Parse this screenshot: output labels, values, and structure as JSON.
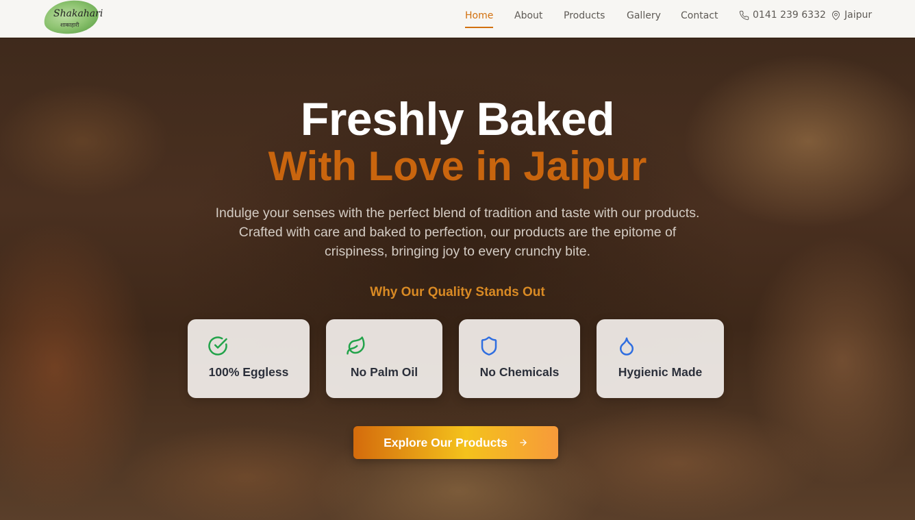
{
  "brand": {
    "name": "Shakahari",
    "subtitle": "शाकाहारी"
  },
  "nav": {
    "links": [
      "Home",
      "About",
      "Products",
      "Gallery",
      "Contact"
    ],
    "active": "Home",
    "phone": "0141 239 6332",
    "location": "Jaipur"
  },
  "hero": {
    "title": "Freshly Baked",
    "subtitle": "With Love in Jaipur",
    "description": "Indulge your senses with the perfect blend of tradition and taste with our products. Crafted with care and baked to perfection, our products are the epitome of crispiness, bringing joy to every crunchy bite.",
    "quality_heading": "Why Our Quality Stands Out",
    "features": [
      {
        "label": "100% Eggless",
        "icon": "check-circle-icon",
        "color": "#22a34a"
      },
      {
        "label": "No Palm Oil",
        "icon": "leaf-icon",
        "color": "#22a34a"
      },
      {
        "label": "No Chemicals",
        "icon": "shield-icon",
        "color": "#2f6ee0"
      },
      {
        "label": "Hygienic Made",
        "icon": "droplet-icon",
        "color": "#2f6ee0"
      }
    ],
    "cta_label": "Explore Our Products"
  },
  "colors": {
    "accent": "#d2700e",
    "subtitle": "#c9650e",
    "green": "#22a34a",
    "blue": "#2f6ee0"
  }
}
